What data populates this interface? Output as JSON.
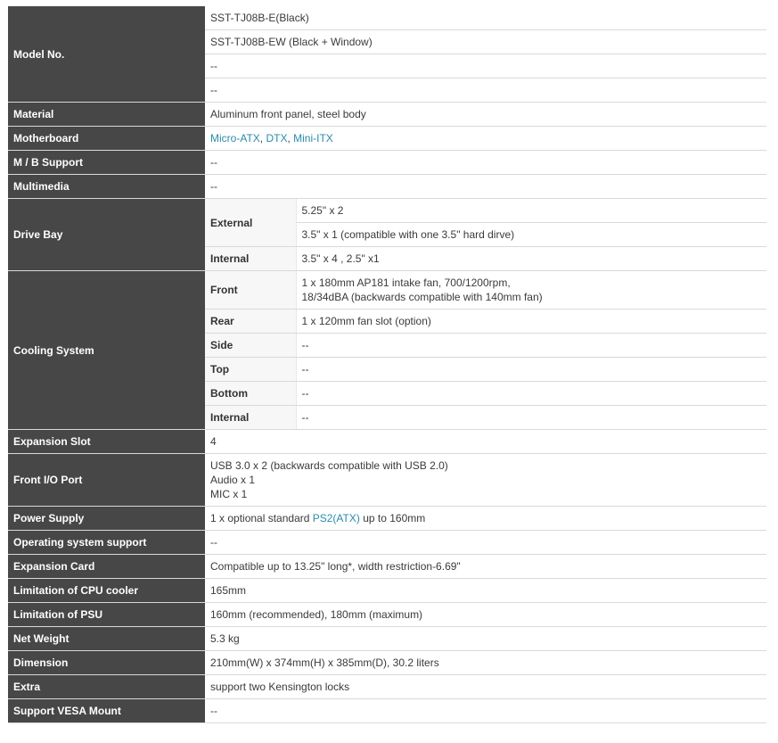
{
  "rows": {
    "model_no": {
      "label": "Model No.",
      "values": [
        "SST-TJ08B-E(Black)",
        "SST-TJ08B-EW (Black + Window)",
        "--",
        "--"
      ]
    },
    "material": {
      "label": "Material",
      "value": "Aluminum front panel, steel body"
    },
    "motherboard": {
      "label": "Motherboard",
      "links": [
        "Micro-ATX",
        "DTX",
        "Mini-ITX"
      ],
      "separator": ", "
    },
    "mb_support": {
      "label": "M / B Support",
      "value": "--"
    },
    "multimedia": {
      "label": "Multimedia",
      "value": "--"
    },
    "drive_bay": {
      "label": "Drive Bay",
      "external_label": "External",
      "external_values": [
        "5.25\" x 2",
        "3.5\" x 1 (compatible with one 3.5\" hard dirve)"
      ],
      "internal_label": "Internal",
      "internal_value": "3.5\" x 4 , 2.5\" x1"
    },
    "cooling": {
      "label": "Cooling System",
      "front_label": "Front",
      "front_line1": "1 x 180mm AP181 intake fan, 700/1200rpm,",
      "front_line2": "18/34dBA (backwards compatible with 140mm fan)",
      "rear_label": "Rear",
      "rear_value": "1 x 120mm fan slot (option)",
      "side_label": "Side",
      "side_value": "--",
      "top_label": "Top",
      "top_value": "--",
      "bottom_label": "Bottom",
      "bottom_value": "--",
      "internal_label": "Internal",
      "internal_value": "--"
    },
    "expansion_slot": {
      "label": "Expansion Slot",
      "value": "4"
    },
    "front_io": {
      "label": "Front I/O Port",
      "lines": [
        "USB 3.0 x 2 (backwards compatible with USB 2.0)",
        "Audio x 1",
        "MIC x 1"
      ]
    },
    "power_supply": {
      "label": "Power Supply",
      "prefix": "1 x optional standard ",
      "link": "PS2(ATX)",
      "suffix": " up to 160mm"
    },
    "os_support": {
      "label": "Operating system support",
      "value": "--"
    },
    "expansion_card": {
      "label": "Expansion Card",
      "value": "Compatible up to 13.25\" long*, width restriction-6.69\""
    },
    "cpu_cooler": {
      "label": "Limitation of CPU cooler",
      "value": "165mm"
    },
    "psu_limit": {
      "label": "Limitation of PSU",
      "value": "160mm (recommended), 180mm (maximum)"
    },
    "net_weight": {
      "label": "Net Weight",
      "value": "5.3 kg"
    },
    "dimension": {
      "label": "Dimension",
      "value": "210mm(W) x 374mm(H) x 385mm(D), 30.2 liters"
    },
    "extra": {
      "label": "Extra",
      "value": "support two Kensington locks"
    },
    "vesa": {
      "label": "Support VESA Mount",
      "value": "--"
    }
  },
  "colors": {
    "label_bg": "#474747",
    "label_text": "#ffffff",
    "sub_bg": "#f7f7f7",
    "link": "#2a8bab",
    "divider": "#d9d9d9"
  }
}
